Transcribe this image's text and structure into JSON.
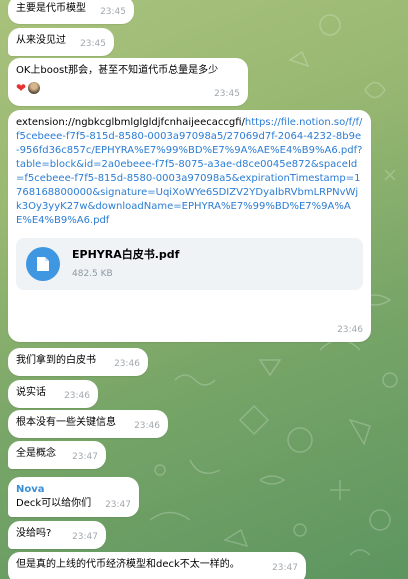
{
  "messages": [
    {
      "text": "主要是代币模型",
      "time": "23:45"
    },
    {
      "text": "从来没见过",
      "time": "23:45"
    },
    {
      "text": "OK上boost那会，甚至不知道代币总量是多少",
      "time": "23:45",
      "reactions": [
        "heart",
        "avatar"
      ]
    },
    {
      "prefix": "extension://ngbkcglbmlglgldjfcnhaijeecaccgfi/",
      "link": "https://file.notion.so/f/f/f5cebeee-f7f5-815d-8580-0003a97098a5/27069d7f-2064-4232-8b9e-956fd36c857c/EPHYRA%E7%99%BD%E7%9A%AE%E4%B9%A6.pdf?table=block&id=2a0ebeee-f7f5-8075-a3ae-d8ce0045e872&spaceId=f5cebeee-f7f5-815d-8580-0003a97098a5&expirationTimestamp=1768168800000&signature=UqiXoWYe6SDIZV2YDyalbRVbmLRPNvWjk3Oy3yyK27w&downloadName=EPHYRA%E7%99%BD%E7%9A%AE%E4%B9%A6.pdf",
      "file": {
        "name": "EPHYRA白皮书.pdf",
        "size": "482.5 KB"
      },
      "time": "23:46"
    },
    {
      "text": "我们拿到的白皮书",
      "time": "23:46"
    },
    {
      "text": "说实话",
      "time": "23:46"
    },
    {
      "text": "根本没有一些关键信息",
      "time": "23:46"
    },
    {
      "text": "全是概念",
      "time": "23:47"
    },
    {
      "sender": "Nova",
      "text": "Deck可以给你们",
      "time": "23:47"
    },
    {
      "text": "没给吗?",
      "time": "23:47"
    },
    {
      "text": "但是真的上线的代币经济模型和deck不太一样的。",
      "time": "23:47"
    }
  ],
  "colors": {
    "bubble": "#ffffff",
    "link": "#2b7cd3",
    "sender": "#3a8fd6",
    "file_icon": "#3e97e0",
    "timestamp": "#a3a9ae"
  }
}
